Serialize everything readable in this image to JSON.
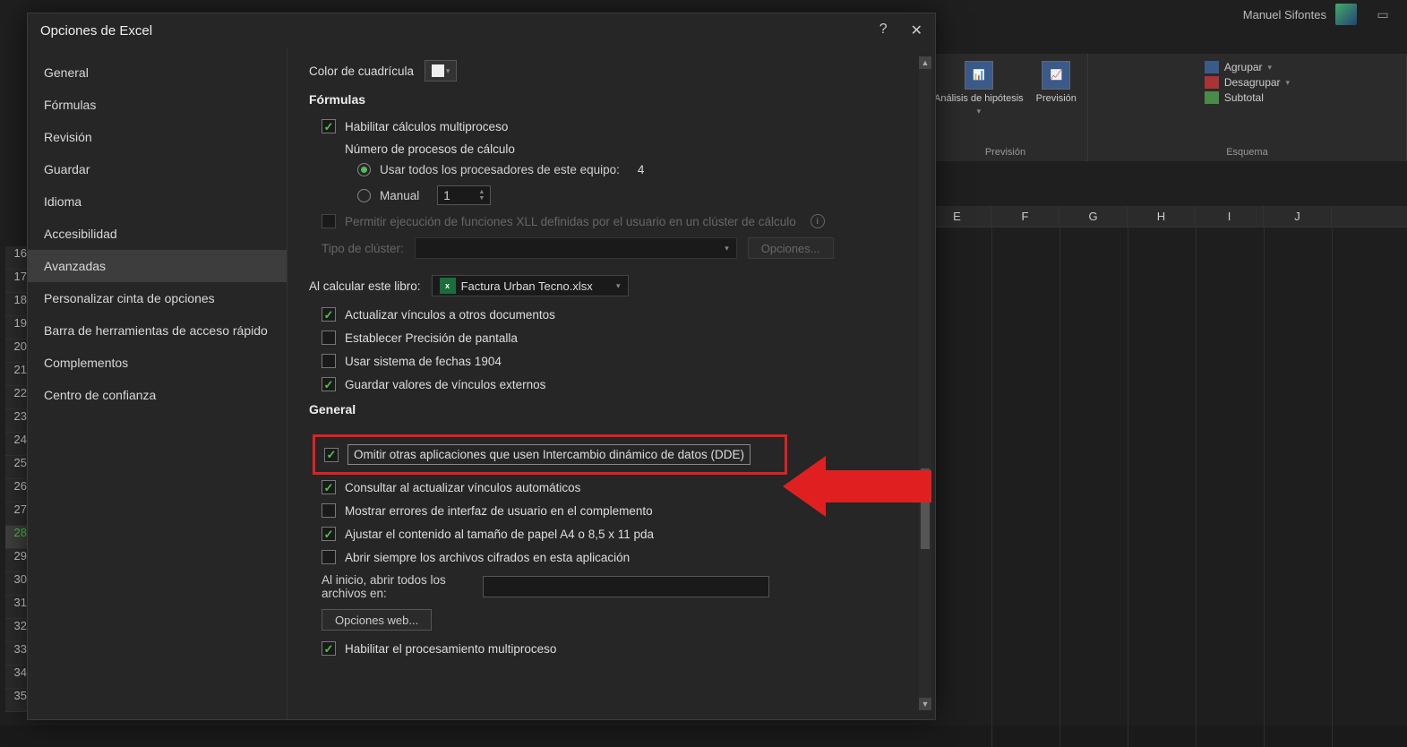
{
  "titlebar": {
    "username": "Manuel Sifontes"
  },
  "ribbon": {
    "prevision": {
      "analysis": "Análisis de hipótesis",
      "forecast": "Previsión",
      "group_label": "Previsión"
    },
    "outline": {
      "group": "Agrupar",
      "ungroup": "Desagrupar",
      "subtotal": "Subtotal",
      "group_label": "Esquema"
    }
  },
  "columns": [
    "E",
    "F",
    "G",
    "H",
    "I",
    "J"
  ],
  "rows": [
    "16",
    "17",
    "18",
    "19",
    "20",
    "21",
    "22",
    "23",
    "24",
    "25",
    "26",
    "27",
    "28",
    "29",
    "30",
    "31",
    "32",
    "33",
    "34",
    "35"
  ],
  "row_selected": "28",
  "dialog": {
    "title": "Opciones de Excel",
    "sidebar": [
      "General",
      "Fórmulas",
      "Revisión",
      "Guardar",
      "Idioma",
      "Accesibilidad",
      "Avanzadas",
      "Personalizar cinta de opciones",
      "Barra de herramientas de acceso rápido",
      "Complementos",
      "Centro de confianza"
    ],
    "sidebar_selected": "Avanzadas",
    "gridcolor_label": "Color de cuadrícula",
    "formulas": {
      "heading": "Fórmulas",
      "multithread": "Habilitar cálculos multiproceso",
      "num_threads_label": "Número de procesos de cálculo",
      "use_all": "Usar todos los procesadores de este equipo:",
      "use_all_count": "4",
      "manual": "Manual",
      "manual_value": "1",
      "xll_disabled": "Permitir ejecución de funciones XLL definidas por el usuario en un clúster de cálculo",
      "cluster_type": "Tipo de clúster:",
      "options_btn": "Opciones..."
    },
    "calc": {
      "label": "Al calcular este libro:",
      "file": "Factura Urban Tecno.xlsx",
      "c1": "Actualizar vínculos a otros documentos",
      "c2": "Establecer Precisión de pantalla",
      "c3": "Usar sistema de fechas 1904",
      "c4": "Guardar valores de vínculos externos"
    },
    "general": {
      "heading": "General",
      "dde": "Omitir otras aplicaciones que usen Intercambio dinámico de datos (DDE)",
      "ask_links": "Consultar al actualizar vínculos automáticos",
      "show_addin_err": "Mostrar errores de interfaz de usuario en el complemento",
      "a4": "Ajustar el contenido al tamaño de papel A4 o 8,5 x 11 pda",
      "open_encrypted": "Abrir siempre los archivos cifrados en esta aplicación",
      "startup_label": "Al inicio, abrir todos los archivos en:",
      "web_options": "Opciones web...",
      "multithread_proc": "Habilitar el procesamiento multiproceso"
    }
  }
}
